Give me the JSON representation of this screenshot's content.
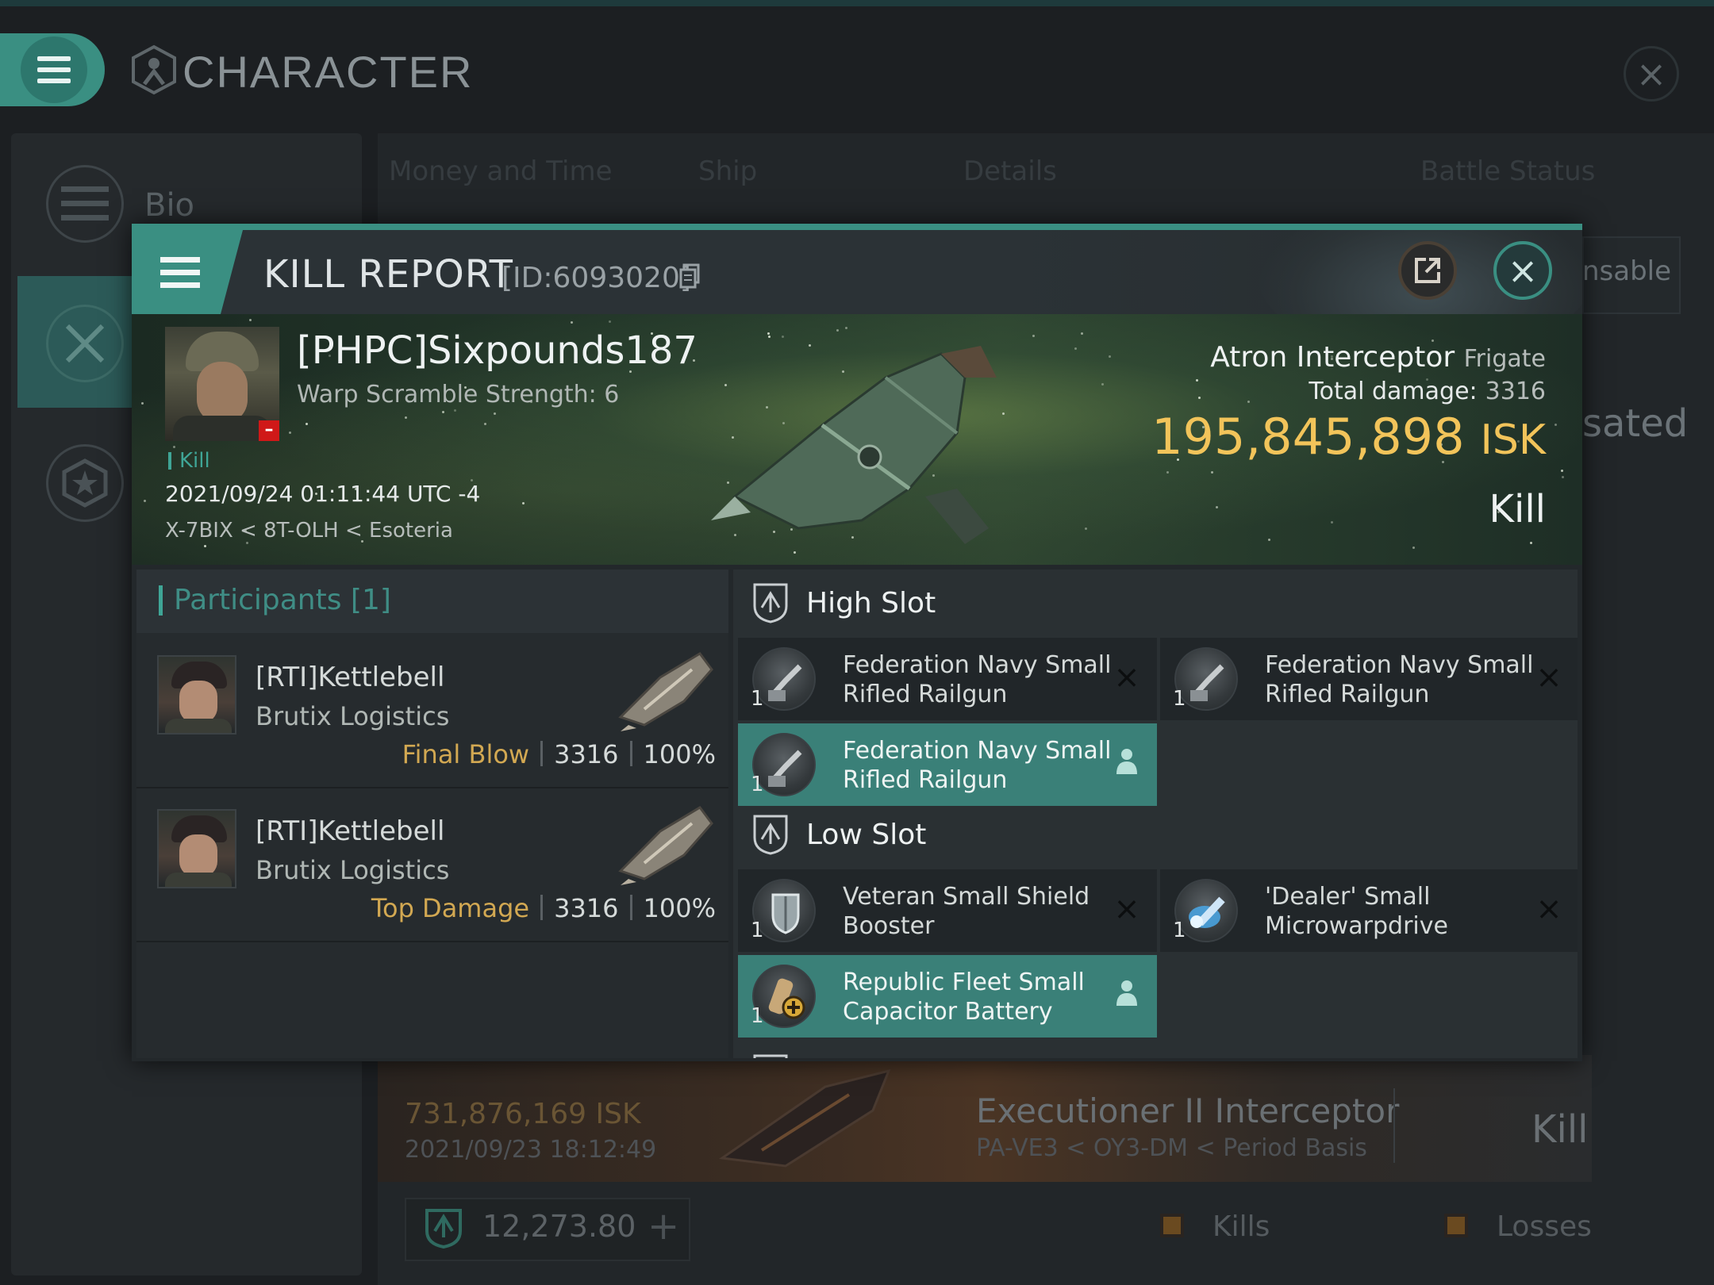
{
  "app": {
    "window_title": "CHARACTER",
    "sidebar": [
      {
        "label": "Bio",
        "icon": "menu-icon"
      },
      {
        "label": "",
        "icon": "combat-icon"
      },
      {
        "label": "",
        "icon": "star-icon"
      }
    ],
    "background_tabs": [
      "Money and Time",
      "Ship",
      "Details",
      "Battle Status"
    ],
    "background_right_texts": [
      "nsable",
      "sated"
    ],
    "background_kill": {
      "isk": "731,876,169  ISK",
      "date": "2021/09/23  18:12:49",
      "ship": "Executioner II Interceptor",
      "location": "PA-VE3 < OY3-DM < Period Basis",
      "type": "Kill"
    },
    "footer": {
      "value": "12,273.80",
      "legend": [
        "Kills",
        "Losses"
      ]
    }
  },
  "kill_report": {
    "title": "KILL REPORT",
    "id_label": "[ID:6093020]",
    "victim": {
      "name": "[PHPC]Sixpounds187",
      "warp_scramble": "Warp Scramble Strength: 6",
      "tag": "Kill",
      "datetime": "2021/09/24 01:11:44 UTC -4",
      "location": "X-7BIX < 8T-OLH < Esoteria"
    },
    "ship": {
      "name": "Atron Interceptor",
      "class": "Frigate",
      "total_damage_label": "Total damage:",
      "total_damage": "3316",
      "isk_value": "195,845,898",
      "isk_unit": "ISK",
      "result": "Kill"
    },
    "participants_title": "Participants [1]",
    "participants": [
      {
        "name": "[RTI]Kettlebell",
        "ship": "Brutix Logistics",
        "label": "Final Blow",
        "damage": "3316",
        "percent": "100%"
      },
      {
        "name": "[RTI]Kettlebell",
        "ship": "Brutix Logistics",
        "label": "Top Damage",
        "damage": "3316",
        "percent": "100%"
      }
    ],
    "slots": {
      "high": {
        "label": "High Slot",
        "items": [
          {
            "name": "Federation Navy Small Rifled Railgun",
            "qty": "1",
            "status": "destroyed",
            "icon": "railgun-icon"
          },
          {
            "name": "Federation Navy Small Rifled Railgun",
            "qty": "1",
            "status": "destroyed",
            "icon": "railgun-icon"
          },
          {
            "name": "Federation Navy Small Rifled Railgun",
            "qty": "1",
            "status": "dropped",
            "icon": "railgun-icon"
          }
        ]
      },
      "low": {
        "label": "Low Slot",
        "items": [
          {
            "name": "Veteran Small Shield Booster",
            "qty": "1",
            "status": "destroyed",
            "icon": "shield-booster-icon"
          },
          {
            "name": "'Dealer' Small Microwarpdrive",
            "qty": "1",
            "status": "destroyed",
            "icon": "microwarpdrive-icon"
          },
          {
            "name": "Republic Fleet Small Capacitor Battery",
            "qty": "1",
            "status": "dropped",
            "icon": "capacitor-battery-icon"
          }
        ]
      }
    }
  },
  "colors": {
    "accent_teal": "#3a8f82",
    "isk_gold": "#f2c45a",
    "participant_label": "#d2a852",
    "dropped_bg": "#3a8078"
  }
}
